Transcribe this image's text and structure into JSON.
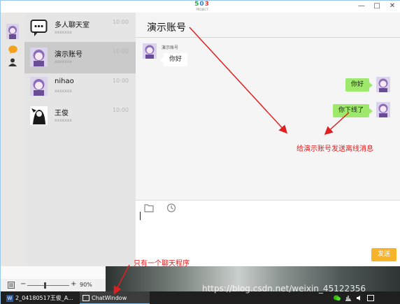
{
  "window": {
    "logo_digits": [
      "5",
      "0",
      "3"
    ],
    "logo_sub": "PROJECT",
    "minimize_glyph": "—",
    "maximize_glyph": "□",
    "close_glyph": "✕"
  },
  "conversations": [
    {
      "name": "多人聊天室",
      "sub": "xxxxxxx",
      "time": "10:00",
      "icon": "group-chat-icon"
    },
    {
      "name": "演示账号",
      "sub": "xxxxxxx",
      "time": "10:00",
      "icon": "anime-avatar"
    },
    {
      "name": "nihao",
      "sub": "xxxxxxx",
      "time": "10:00",
      "icon": "anime-avatar"
    },
    {
      "name": "王俊",
      "sub": "xxxxxxx",
      "time": "10:00",
      "icon": "bw-avatar"
    }
  ],
  "chat": {
    "title": "演示账号",
    "messages": [
      {
        "side": "left",
        "sender": "演示账号",
        "text": "你好"
      },
      {
        "side": "right",
        "text": "你好"
      },
      {
        "side": "right",
        "text": "你下线了"
      }
    ],
    "send_label": "发送"
  },
  "annotations": {
    "offline_note": "给演示账号发送离线消息",
    "single_program_note": "只有一个聊天程序"
  },
  "word_status": {
    "zoom_minus": "−",
    "zoom_plus": "+",
    "zoom_level": "90%"
  },
  "taskbar": {
    "word_task": "2_04180517王俊_A...",
    "chat_task": "ChatWindow",
    "watermark": "https://blog.csdn.net/weixin_45122356"
  },
  "colors": {
    "accent_send": "#f7b32a",
    "bubble_self": "#9ee86b",
    "annotation": "#e02020"
  }
}
